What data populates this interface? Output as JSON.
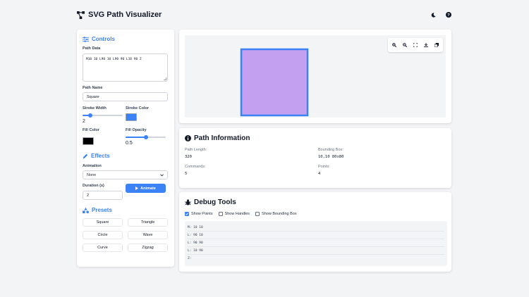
{
  "app": {
    "title": "SVG Path Visualizer"
  },
  "controls": {
    "title": "Controls",
    "path_data_label": "Path Data",
    "path_data_value": "M10 10 L90 10 L90 90 L10 90 Z",
    "path_name_label": "Path Name",
    "path_name_value": "Square",
    "stroke_width_label": "Stroke Width",
    "stroke_width_value": "2",
    "stroke_width_level": 0.2,
    "stroke_color_label": "Stroke Color",
    "stroke_color": "#3b82f6",
    "fill_color_label": "Fill Color",
    "fill_color": "#000000",
    "fill_opacity_label": "Fill Opacity",
    "fill_opacity_value": "0.5",
    "fill_opacity_level": 0.5
  },
  "effects": {
    "title": "Effects",
    "animation_label": "Animation",
    "animation_value": "None",
    "duration_label": "Duration (s)",
    "duration_value": "2",
    "animate_button": "Animate"
  },
  "presets": {
    "title": "Presets",
    "items": [
      "Square",
      "Triangle",
      "Circle",
      "Wave",
      "Curve",
      "Zigzag"
    ]
  },
  "canvas": {
    "shape_fill": "#c4a0f0",
    "shape_stroke": "#3b82f6",
    "toolbar_icons": [
      "zoom-in-icon",
      "zoom-out-icon",
      "fit-screen-icon",
      "download-icon",
      "copy-icon"
    ]
  },
  "info": {
    "title": "Path Information",
    "path_length_label": "Path Length:",
    "path_length_value": "320",
    "bounding_box_label": "Bounding Box:",
    "bounding_box_value": "10,10 80x80",
    "commands_label": "Commands:",
    "commands_value": "5",
    "points_label": "Points:",
    "points_value": "4"
  },
  "debug": {
    "title": "Debug Tools",
    "show_points": "Show Points",
    "show_points_checked": true,
    "show_handles": "Show Handles",
    "show_handles_checked": false,
    "show_bbox": "Show Bounding Box",
    "show_bbox_checked": false,
    "lines": [
      "M: 10 10",
      "L: 90 10",
      "L: 90 90",
      "L: 10 90",
      "Z:"
    ]
  },
  "colors": {
    "accent": "#3b82f6"
  }
}
